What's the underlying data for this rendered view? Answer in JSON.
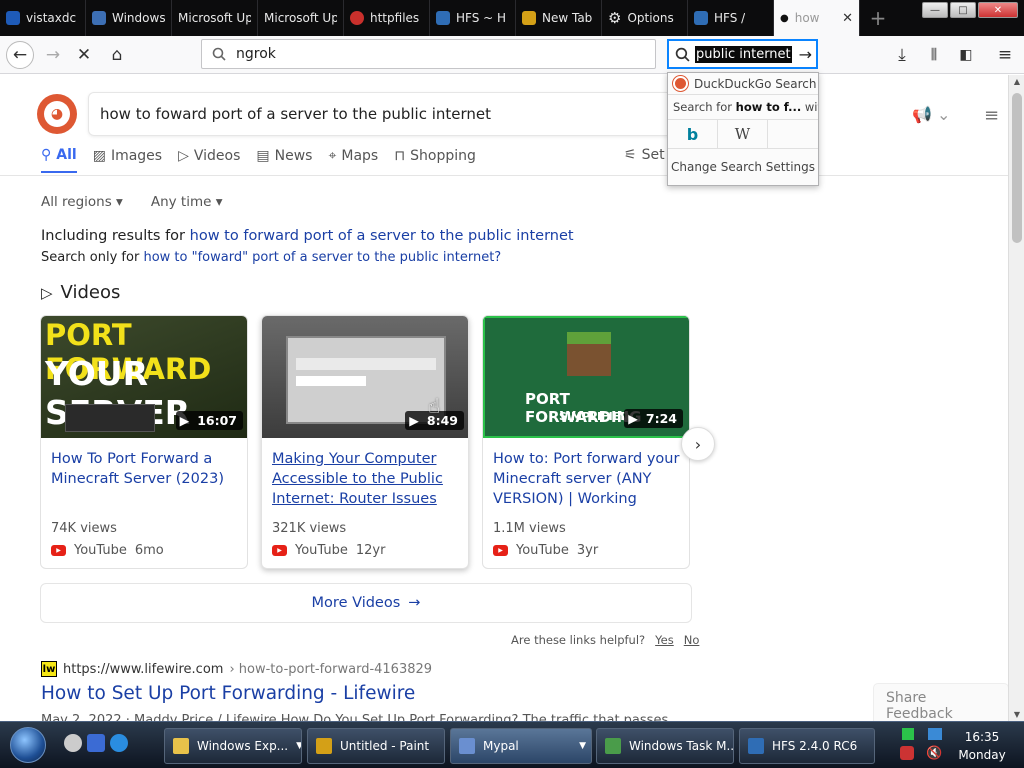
{
  "tabs": [
    {
      "label": "vistaxdc",
      "color": "#1e5bb8"
    },
    {
      "label": "Windows",
      "color": "#3d6fb4"
    },
    {
      "label": "Microsoft Up",
      "color": "#7a7a7a"
    },
    {
      "label": "Microsoft Up",
      "color": "#7a7a7a"
    },
    {
      "label": "httpfiles",
      "color": "#c9302c"
    },
    {
      "label": "HFS ~ H",
      "color": "#2f6db5"
    },
    {
      "label": "New Tab",
      "color": "#d4a017"
    },
    {
      "label": "Options",
      "color": "#cccccc"
    },
    {
      "label": "HFS /",
      "color": "#2f6db5"
    },
    {
      "label": "how",
      "color": "#de5833"
    }
  ],
  "window_controls": {
    "minimize": "—",
    "maximize": "□",
    "close": "✕"
  },
  "navbar": {
    "url_text": "ngrok",
    "search_selected": "public internet"
  },
  "popup": {
    "engine_title": "DuckDuckGo Search",
    "search_for_prefix": "Search for",
    "search_for_query": "how to f...",
    "search_for_suffix": "with:",
    "change_settings": "Change Search Settings"
  },
  "serp": {
    "query": "how to foward port of a server to the public internet",
    "tabs": [
      "All",
      "Images",
      "Videos",
      "News",
      "Maps",
      "Shopping"
    ],
    "settings_tab": "Set",
    "filter_regions": "All regions",
    "filter_time": "Any time",
    "including_prefix": "Including results for",
    "including_link": "how to forward port of a server to the public internet",
    "searchonly_prefix": "Search only for",
    "searchonly_link": "how to \"foward\" port of a server to the public internet?",
    "videos_heading": "Videos",
    "videos": [
      {
        "title": "How To Port Forward a Minecraft Server (2023)",
        "duration": "16:07",
        "views": "74K views",
        "source": "YouTube",
        "age": "6mo",
        "thumb_line1": "PORT FORWARD",
        "thumb_line2": "YOUR SERVER"
      },
      {
        "title": "Making Your Computer Accessible to the Public Internet: Router Issues",
        "duration": "8:49",
        "views": "321K views",
        "source": "YouTube",
        "age": "12yr"
      },
      {
        "title": "How to: Port forward your Minecraft server (ANY VERSION) | Working",
        "duration": "7:24",
        "views": "1.1M views",
        "source": "YouTube",
        "age": "3yr",
        "thumb_line1": "PORT FORWARDING",
        "thumb_line2": "SIMPLIFIED"
      }
    ],
    "more_videos": "More Videos",
    "helpful_q": "Are these links helpful?",
    "helpful_yes": "Yes",
    "helpful_no": "No",
    "result": {
      "domain": "https://www.lifewire.com",
      "path": "› how-to-port-forward-4163829",
      "title": "How to Set Up Port Forwarding - Lifewire",
      "snippet": "May 2, 2022 · Maddy Price / Lifewire How Do You Set Up Port Forwarding? The traffic that passes"
    },
    "share_feedback": "Share Feedback"
  },
  "taskbar": {
    "buttons": [
      {
        "label": "Windows Exp...",
        "color": "#e8c24a"
      },
      {
        "label": "Untitled - Paint",
        "color": "#d4a017"
      },
      {
        "label": "Mypal",
        "color": "#6a8fd0"
      },
      {
        "label": "Windows Task M...",
        "color": "#4a9c4a"
      },
      {
        "label": "HFS 2.4.0 RC6",
        "color": "#2f6db5"
      }
    ],
    "clock_time": "16:35",
    "clock_day": "Monday"
  }
}
